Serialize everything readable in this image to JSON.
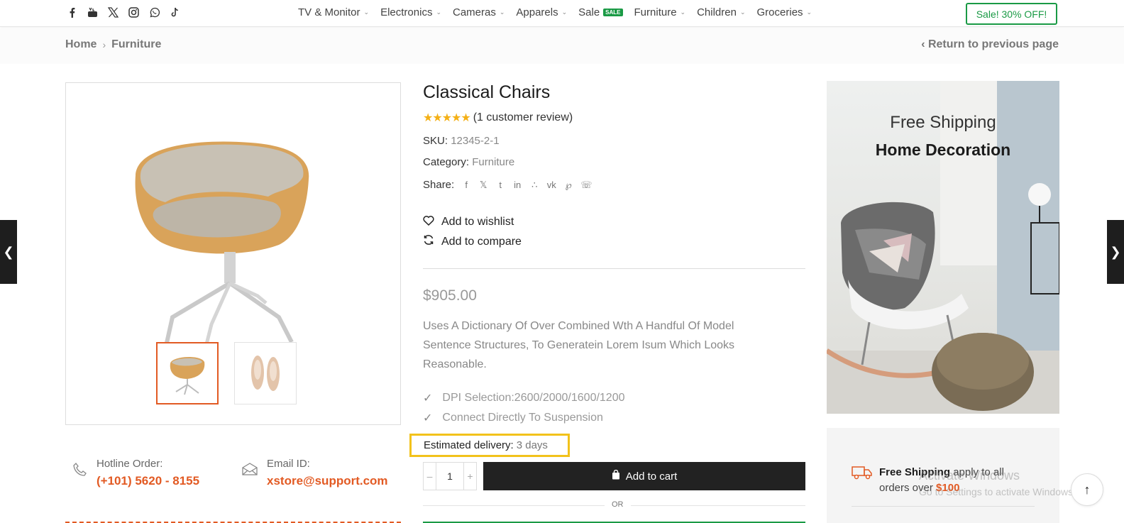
{
  "nav": {
    "socials": [
      "facebook-icon",
      "youtube-icon",
      "x-icon",
      "instagram-icon",
      "whatsapp-icon",
      "tiktok-icon"
    ],
    "items": [
      {
        "label": "TV & Monitor"
      },
      {
        "label": "Electronics"
      },
      {
        "label": "Cameras"
      },
      {
        "label": "Apparels"
      },
      {
        "label": "Sale",
        "badge": "SALE"
      },
      {
        "label": "Furniture"
      },
      {
        "label": "Children"
      },
      {
        "label": "Groceries"
      }
    ],
    "promo": "Sale! 30% OFF!"
  },
  "breadcrumb": {
    "home": "Home",
    "current": "Furniture",
    "return": "Return to previous page"
  },
  "product": {
    "title": "Classical Chairs",
    "rating": 5,
    "reviews": "(1 customer review)",
    "sku_label": "SKU:",
    "sku": "12345-2-1",
    "category_label": "Category:",
    "category": "Furniture",
    "share_label": "Share:",
    "share_icons": [
      "facebook-icon",
      "x-icon",
      "tumblr-icon",
      "linkedin-icon",
      "houzz-icon",
      "vk-icon",
      "pinterest-icon",
      "whatsapp-icon"
    ],
    "wishlist": "Add to wishlist",
    "compare": "Add to compare",
    "price": "$905.00",
    "description": "Uses A Dictionary Of Over Combined Wth A Handful Of Model Sentence Structures, To Generatein Lorem Isum Which Looks Reasonable.",
    "features": [
      "DPI Selection:2600/2000/1600/1200",
      "Connect Directly To Suspension"
    ],
    "delivery_label": "Estimated delivery:",
    "delivery_value": "3 days",
    "qty": "1",
    "add_to_cart": "Add to cart",
    "or": "OR"
  },
  "contact": {
    "hotline_label": "Hotline Order:",
    "hotline": "(+101) 5620 - 8155",
    "email_label": "Email ID:",
    "email": "xstore@support.com"
  },
  "banner": {
    "line1": "Free Shipping",
    "line2": "Home Decoration"
  },
  "shipping": {
    "bold": "Free Shipping",
    "text": "apply to all orders over",
    "amount": "$100"
  },
  "watermark": {
    "line1": "Activate Windows",
    "line2": "Go to Settings to activate Windows."
  },
  "colors": {
    "accent": "#e25a23",
    "green": "#1a9a45",
    "star": "#f4b016",
    "highlight": "#f2c21b"
  }
}
